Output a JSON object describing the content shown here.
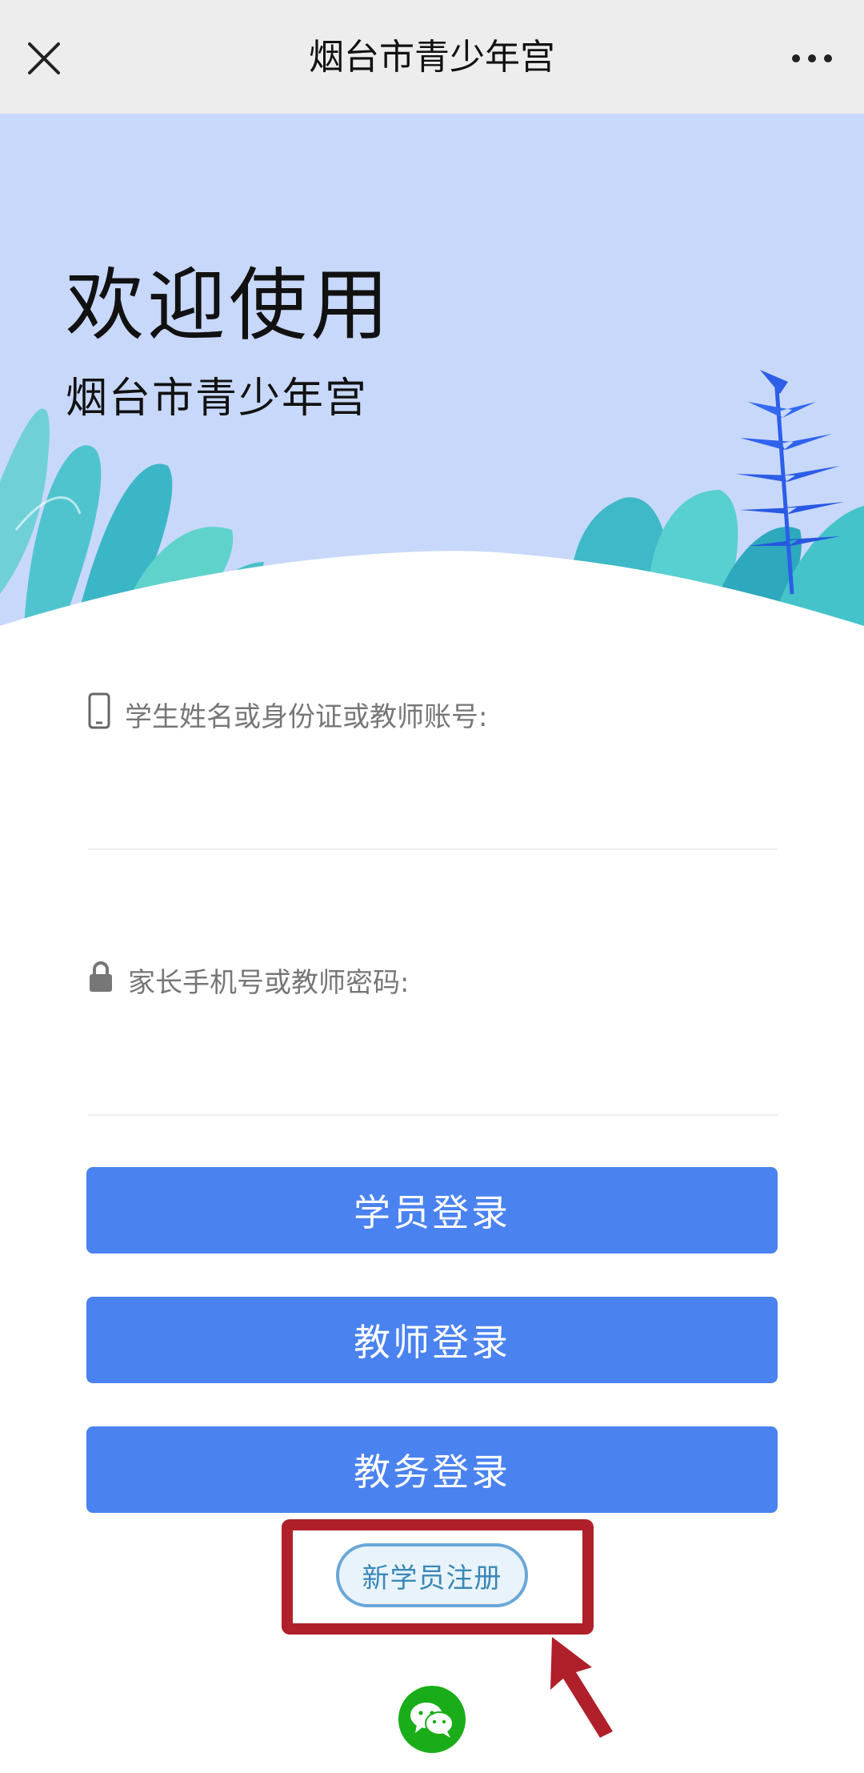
{
  "nav": {
    "title": "烟台市青少年宫",
    "close_icon": "close-icon",
    "more_icon": "more-icon"
  },
  "banner": {
    "welcome": "欢迎使用",
    "subtitle": "烟台市青少年宫"
  },
  "form": {
    "account_label": "学生姓名或身份证或教师账号:",
    "account_value": "",
    "password_label": "家长手机号或教师密码:",
    "password_value": ""
  },
  "buttons": {
    "student_login": "学员登录",
    "teacher_login": "教师登录",
    "admin_login": "教务登录",
    "register": "新学员注册"
  },
  "colors": {
    "primary": "#4a82f0",
    "banner_bg": "#c8d8fb",
    "highlight": "#b0202a",
    "wechat": "#1aad19"
  },
  "icons": {
    "phone": "phone-icon",
    "lock": "lock-icon",
    "wechat": "wechat-icon",
    "arrow": "arrow-icon"
  }
}
